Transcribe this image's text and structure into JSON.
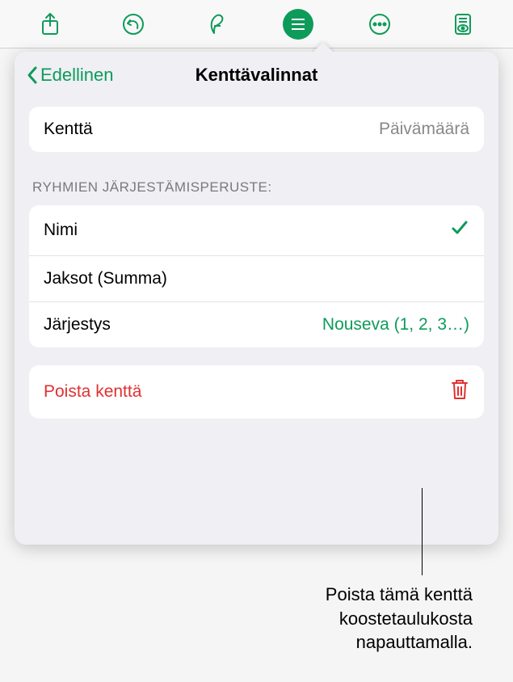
{
  "toolbar": {
    "icons": [
      "share",
      "undo",
      "format",
      "pivot",
      "more",
      "preview"
    ]
  },
  "popover": {
    "back_label": "Edellinen",
    "title": "Kenttävalinnat",
    "field": {
      "label": "Kenttä",
      "value": "Päivämäärä"
    },
    "sort_section": {
      "header": "RYHMIEN JÄRJESTÄMISPERUSTE:",
      "options": [
        {
          "label": "Nimi",
          "selected": true
        },
        {
          "label": "Jaksot (Summa)",
          "selected": false
        }
      ],
      "order": {
        "label": "Järjestys",
        "value": "Nouseva (1, 2, 3…)"
      }
    },
    "delete": {
      "label": "Poista kenttä"
    }
  },
  "callout": {
    "text": "Poista tämä kenttä koostetaulukosta napauttamalla."
  }
}
